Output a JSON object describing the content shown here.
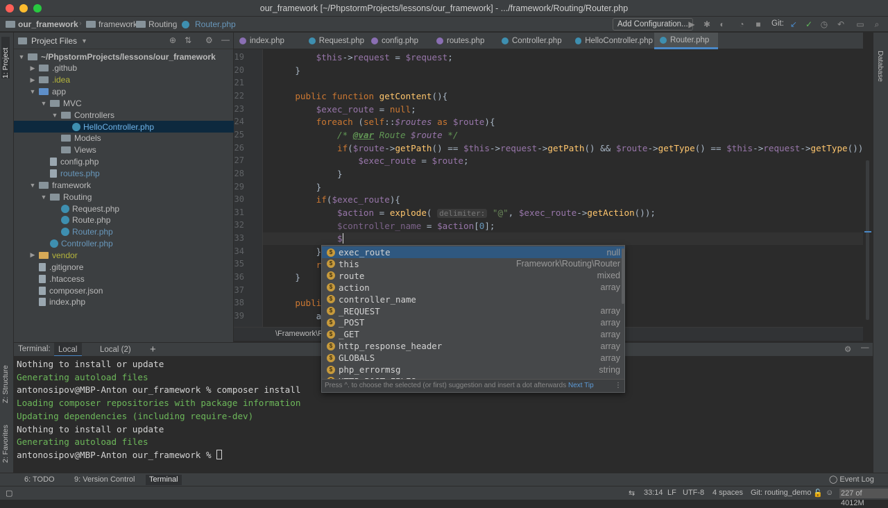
{
  "window": {
    "title": "our_framework [~/PhpstormProjects/lessons/our_framework] - .../framework/Routing/Router.php",
    "traffic_colors": [
      "#ff5f57",
      "#febc2e",
      "#28c840"
    ]
  },
  "navbar": {
    "crumbs": [
      "our_framework",
      "framework",
      "Routing",
      "Router.php"
    ],
    "add_configuration": "Add Configuration...",
    "git_label": "Git:"
  },
  "left_strip": {
    "project_tab": "1: Project",
    "structure_tab": "Z: Structure",
    "favorites_tab": "2: Favorites"
  },
  "right_strip": {
    "database_tab": "Database"
  },
  "project": {
    "header": "Project Files",
    "tree": [
      {
        "label": "~/PhpstormProjects/lessons/our_framework",
        "indent": 0,
        "arrow": "▼",
        "icon": "folder",
        "style": "bold"
      },
      {
        "label": ".github",
        "indent": 1,
        "arrow": "▶",
        "icon": "folder"
      },
      {
        "label": ".idea",
        "indent": 1,
        "arrow": "▶",
        "icon": "folder",
        "style": "olive"
      },
      {
        "label": "app",
        "indent": 1,
        "arrow": "▼",
        "icon": "folder-blue"
      },
      {
        "label": "MVC",
        "indent": 2,
        "arrow": "▼",
        "icon": "folder"
      },
      {
        "label": "Controllers",
        "indent": 3,
        "arrow": "▼",
        "icon": "folder"
      },
      {
        "label": "HelloController.php",
        "indent": 4,
        "arrow": "",
        "icon": "php",
        "style": "sel",
        "selected": true
      },
      {
        "label": "Models",
        "indent": 3,
        "arrow": "",
        "icon": "folder"
      },
      {
        "label": "Views",
        "indent": 3,
        "arrow": "",
        "icon": "folder"
      },
      {
        "label": "config.php",
        "indent": 2,
        "arrow": "",
        "icon": "file"
      },
      {
        "label": "routes.php",
        "indent": 2,
        "arrow": "",
        "icon": "file",
        "style": "blue"
      },
      {
        "label": "framework",
        "indent": 1,
        "arrow": "▼",
        "icon": "folder"
      },
      {
        "label": "Routing",
        "indent": 2,
        "arrow": "▼",
        "icon": "folder"
      },
      {
        "label": "Request.php",
        "indent": 3,
        "arrow": "",
        "icon": "php"
      },
      {
        "label": "Route.php",
        "indent": 3,
        "arrow": "",
        "icon": "php"
      },
      {
        "label": "Router.php",
        "indent": 3,
        "arrow": "",
        "icon": "php",
        "style": "blue"
      },
      {
        "label": "Controller.php",
        "indent": 2,
        "arrow": "",
        "icon": "php",
        "style": "blue"
      },
      {
        "label": "vendor",
        "indent": 1,
        "arrow": "▶",
        "icon": "folder-orange",
        "style": "olive"
      },
      {
        "label": ".gitignore",
        "indent": 1,
        "arrow": "",
        "icon": "file"
      },
      {
        "label": ".htaccess",
        "indent": 1,
        "arrow": "",
        "icon": "file"
      },
      {
        "label": "composer.json",
        "indent": 1,
        "arrow": "",
        "icon": "file"
      },
      {
        "label": "index.php",
        "indent": 1,
        "arrow": "",
        "icon": "file"
      }
    ]
  },
  "tabs": [
    {
      "label": "index.php",
      "color": "#8a6fb3"
    },
    {
      "label": "Request.php",
      "color": "#3e8fb0"
    },
    {
      "label": "config.php",
      "color": "#8a6fb3"
    },
    {
      "label": "routes.php",
      "color": "#8a6fb3"
    },
    {
      "label": "Controller.php",
      "color": "#3e8fb0"
    },
    {
      "label": "HelloController.php",
      "color": "#3e8fb0"
    },
    {
      "label": "Router.php",
      "color": "#3e8fb0",
      "active": true
    }
  ],
  "editor": {
    "line_numbers": [
      "19",
      "20",
      "21",
      "22",
      "23",
      "24",
      "25",
      "26",
      "27",
      "28",
      "29",
      "30",
      "31",
      "32",
      "33",
      "34",
      "35",
      "36",
      "37",
      "38",
      "39"
    ],
    "breadcrumb": "\\Framework\\R"
  },
  "completion": {
    "items": [
      {
        "name": "exec_route",
        "type": "null"
      },
      {
        "name": "this",
        "type": "Framework\\Routing\\Router"
      },
      {
        "name": "route",
        "type": "mixed"
      },
      {
        "name": "action",
        "type": "array"
      },
      {
        "name": "controller_name",
        "type": ""
      },
      {
        "name": "_REQUEST",
        "type": "array"
      },
      {
        "name": "_POST",
        "type": "array"
      },
      {
        "name": "_GET",
        "type": "array"
      },
      {
        "name": "http_response_header",
        "type": "array"
      },
      {
        "name": "GLOBALS",
        "type": "array"
      },
      {
        "name": "php_errormsg",
        "type": "string"
      },
      {
        "name": "HTTP_POST_FILES",
        "type": "array"
      }
    ],
    "footer": "Press ^. to choose the selected (or first) suggestion and insert a dot afterwards",
    "next_tip": "Next Tip"
  },
  "terminal": {
    "label": "Terminal:",
    "tabs": [
      "Local",
      "Local (2)"
    ],
    "add": "+",
    "lines": [
      {
        "text": "Nothing to install or update",
        "color": "white"
      },
      {
        "text": "Generating autoload files",
        "color": "green"
      },
      {
        "text": "antonosipov@MBP-Anton our_framework % composer install",
        "color": "white"
      },
      {
        "text": "Loading composer repositories with package information",
        "color": "green"
      },
      {
        "text": "Updating dependencies (including require-dev)",
        "color": "green"
      },
      {
        "text": "Nothing to install or update",
        "color": "white"
      },
      {
        "text": "Generating autoload files",
        "color": "green"
      },
      {
        "text": "antonosipov@MBP-Anton our_framework % ",
        "color": "white",
        "cursor": true
      }
    ]
  },
  "bottom_tools": {
    "todo": "6: TODO",
    "vcs": "9: Version Control",
    "terminal": "Terminal",
    "event_log": "Event Log"
  },
  "status": {
    "position": "33:14",
    "line_sep": "LF",
    "encoding": "UTF-8",
    "indent": "4 spaces",
    "git": "Git: routing_demo",
    "memory": "227 of 4012M"
  }
}
